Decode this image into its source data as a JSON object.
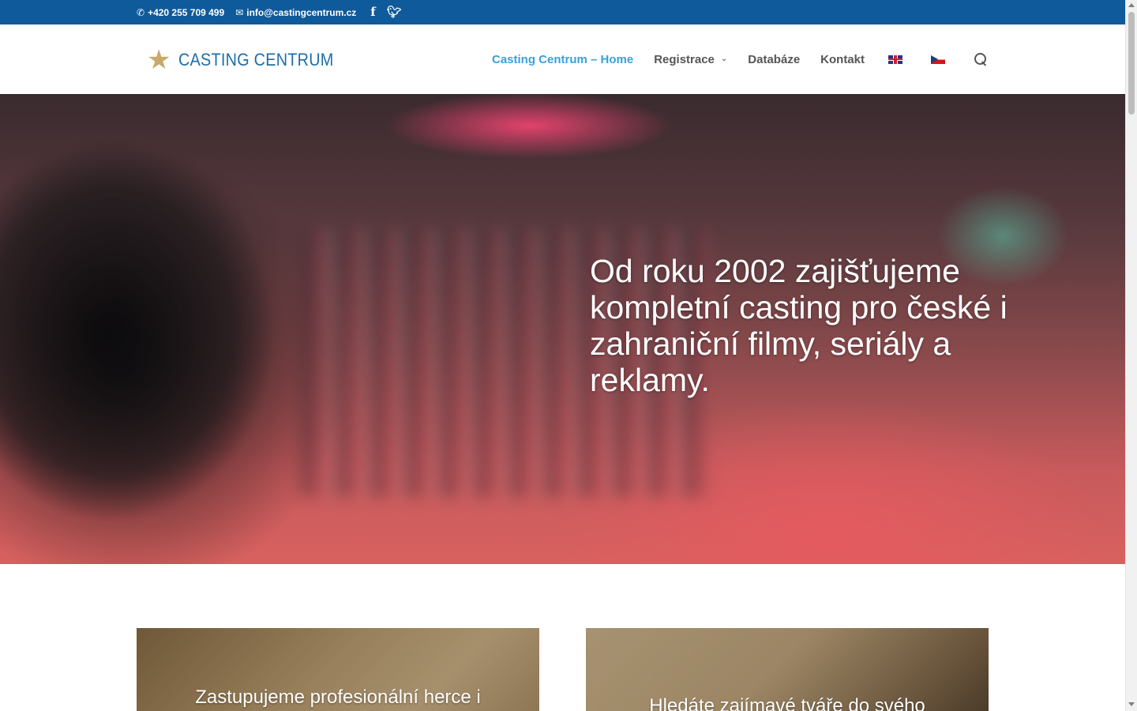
{
  "topbar": {
    "phone": "+420 255 709 499",
    "email": "info@castingcentrum.cz",
    "phone_icon": "phone-icon",
    "email_icon": "envelope-icon",
    "social": [
      "facebook-icon",
      "twitter-icon"
    ]
  },
  "header": {
    "logo_text": "CASTING CENTRUM",
    "nav": [
      {
        "label": "Casting Centrum – Home",
        "active": true
      },
      {
        "label": "Registrace",
        "has_dropdown": true
      },
      {
        "label": "Databáze"
      },
      {
        "label": "Kontakt"
      }
    ],
    "languages": [
      "uk-flag-icon",
      "cz-flag-icon"
    ],
    "search_icon": "search-icon"
  },
  "hero": {
    "headline": "Od roku 2002 zajišťujeme kompletní casting pro české i zahraniční filmy, seriály a reklamy."
  },
  "cards": [
    {
      "title": "Zastupujeme profesionální herce i"
    },
    {
      "title": "Hledáte zajímavé tváře do svého"
    }
  ],
  "colors": {
    "topbar_bg": "#0f5a9a",
    "accent": "#3aa0d8",
    "logo": "#1c6ea8",
    "star": "#c9a86a"
  }
}
